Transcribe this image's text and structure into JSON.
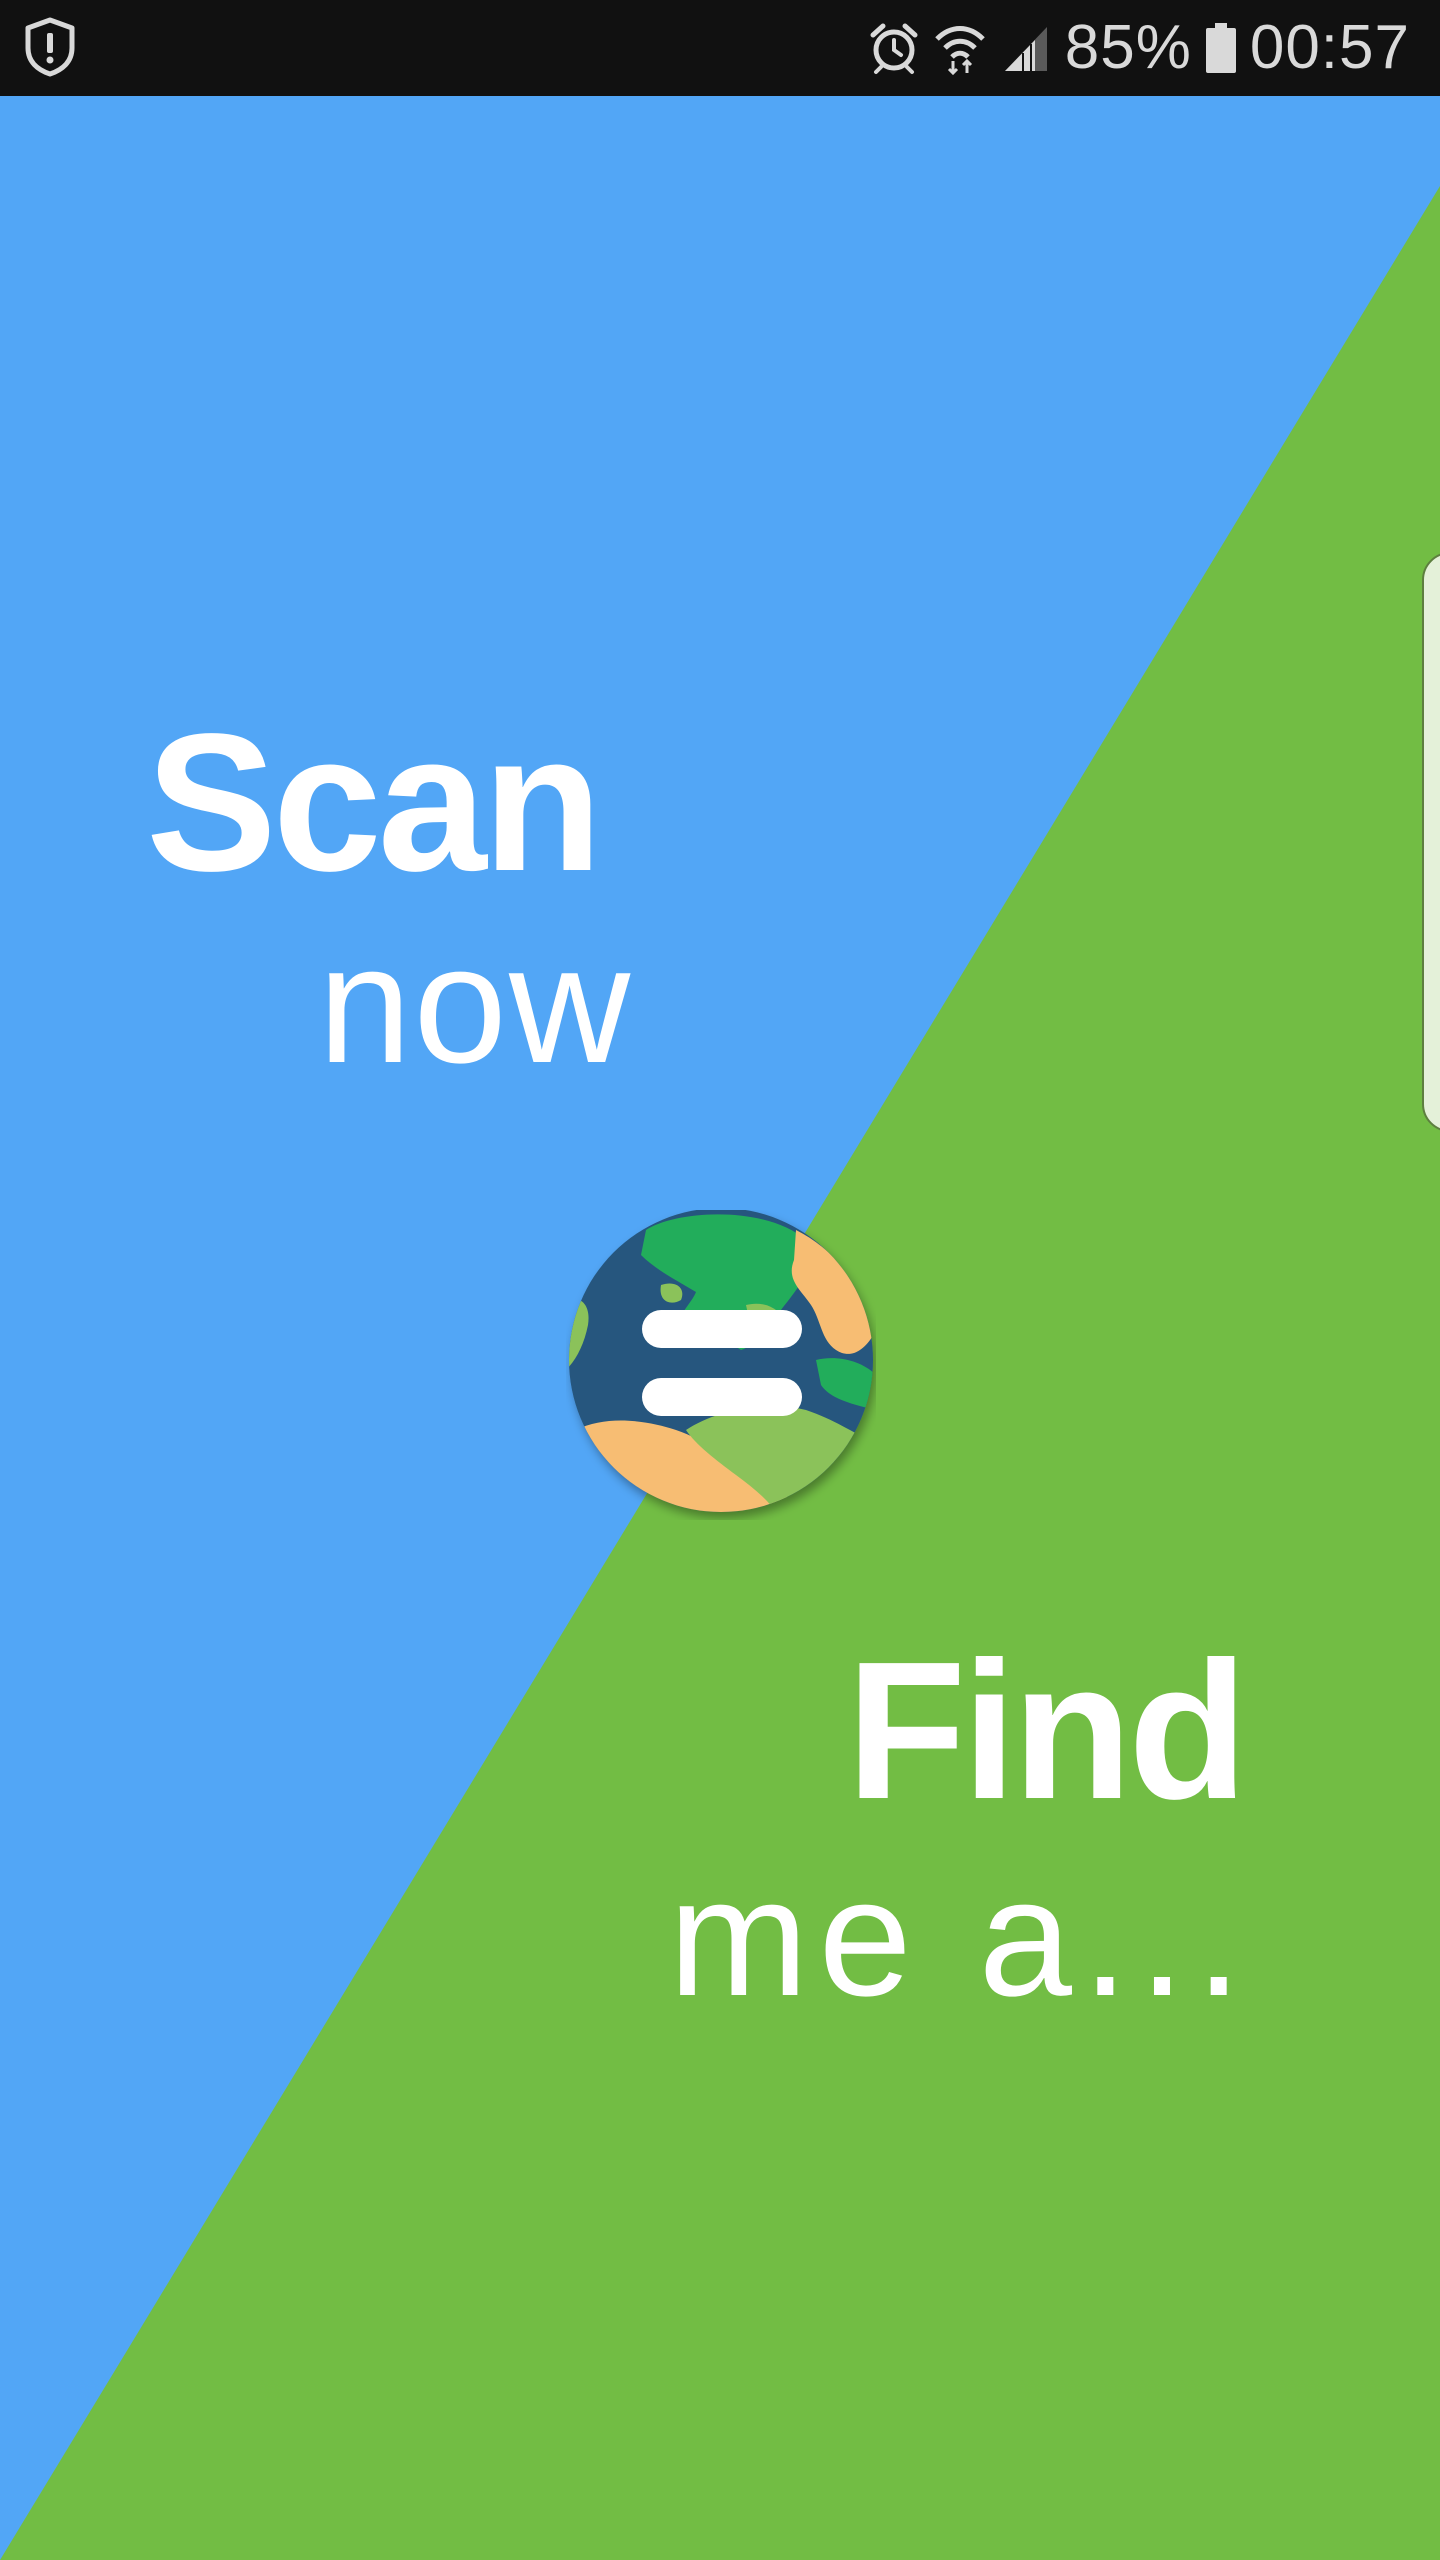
{
  "status_bar": {
    "battery_percent": "85%",
    "time": "00:57",
    "icons": [
      "shield-alert-icon",
      "alarm-icon",
      "wifi-icon",
      "signal-icon",
      "battery-icon"
    ]
  },
  "colors": {
    "top_panel": "#52a6f6",
    "bottom_panel": "#72bd44",
    "globe_ocean": "#27567e",
    "globe_land_green": "#22ad5b",
    "globe_land_light": "#8bc25a",
    "globe_land_sand": "#f7bd73"
  },
  "top_panel": {
    "title": "Scan",
    "subtitle": "now"
  },
  "bottom_panel": {
    "title": "Find",
    "subtitle": "me a..."
  },
  "logo": {
    "icon": "globe-menu-icon"
  }
}
